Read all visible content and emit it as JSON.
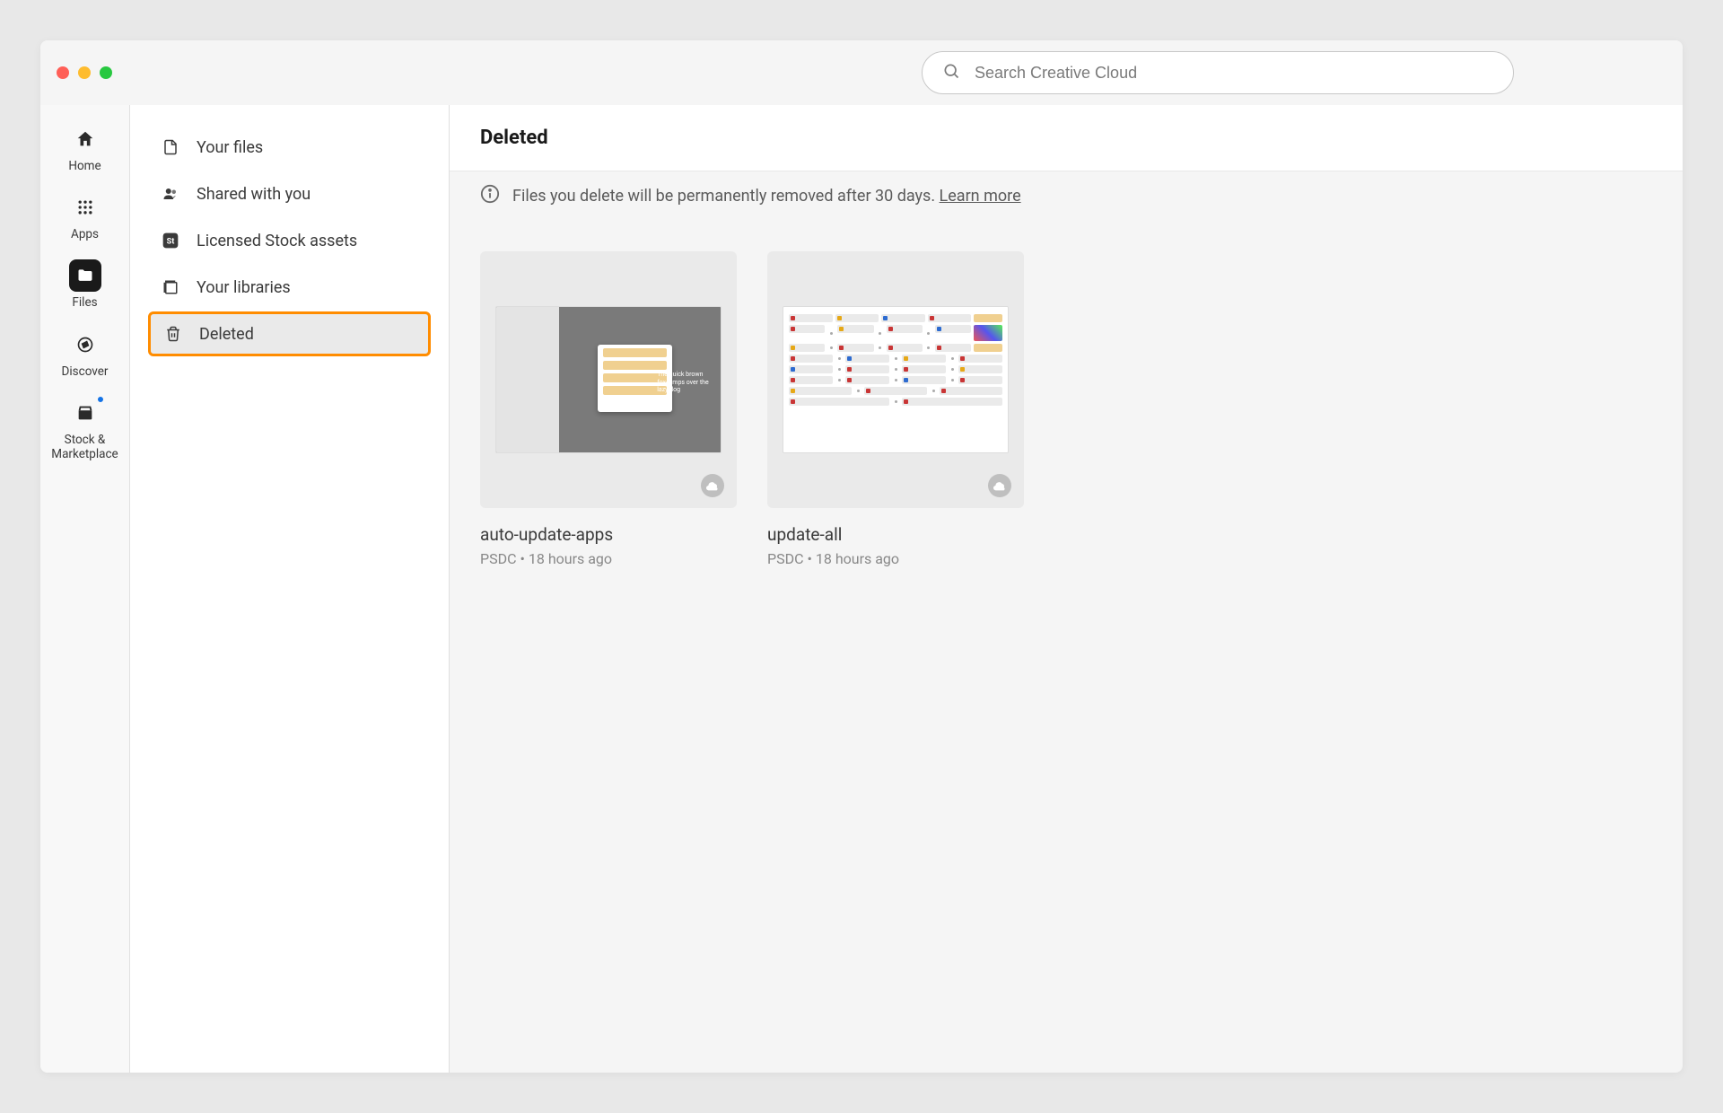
{
  "search": {
    "placeholder": "Search Creative Cloud"
  },
  "rail": {
    "items": [
      {
        "id": "home",
        "label": "Home"
      },
      {
        "id": "apps",
        "label": "Apps"
      },
      {
        "id": "files",
        "label": "Files"
      },
      {
        "id": "discover",
        "label": "Discover"
      },
      {
        "id": "stock",
        "label": "Stock & Marketplace"
      }
    ]
  },
  "sidebar": {
    "items": [
      {
        "label": "Your files"
      },
      {
        "label": "Shared with you"
      },
      {
        "label": "Licensed Stock assets"
      },
      {
        "label": "Your libraries"
      },
      {
        "label": "Deleted"
      }
    ]
  },
  "content": {
    "title": "Deleted",
    "info_text": "Files you delete will be permanently removed after 30 days.",
    "learn_more": "Learn more",
    "files": [
      {
        "name": "auto-update-apps",
        "type": "PSDC",
        "time": "18 hours ago"
      },
      {
        "name": "update-all",
        "type": "PSDC",
        "time": "18 hours ago"
      }
    ]
  }
}
